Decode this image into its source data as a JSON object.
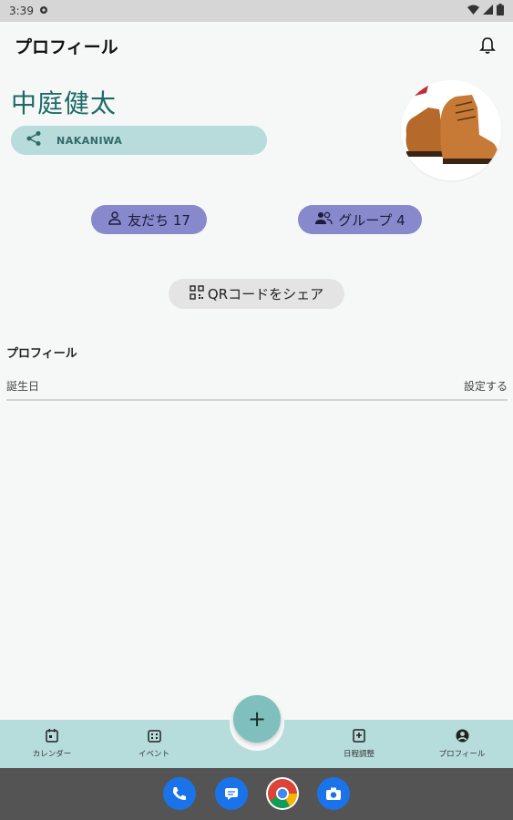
{
  "status_bar": {
    "time": "3:39"
  },
  "app_bar": {
    "title": "プロフィール"
  },
  "profile": {
    "name": "中庭健太",
    "id_text": "NAKANIWA"
  },
  "chips": {
    "friends_label": "友だち 17",
    "groups_label": "グループ 4"
  },
  "qr": {
    "label": "QRコードをシェア"
  },
  "section": {
    "title": "プロフィール",
    "birthday_label": "誕生日",
    "birthday_action": "設定する"
  },
  "bottom_nav": {
    "items": [
      {
        "label": "カレンダー",
        "icon": "calendar-icon"
      },
      {
        "label": "イベント",
        "icon": "event-icon"
      },
      {
        "label": "日程調整",
        "icon": "schedule-icon"
      },
      {
        "label": "プロフィール",
        "icon": "profile-icon"
      }
    ],
    "fab": "+"
  },
  "colors": {
    "accent_teal": "#1c6b67",
    "pill_bg": "#b7dcdb",
    "chip_purple": "#8888cc",
    "fab_bg": "#7fbfbd",
    "nav_bg": "#b6dcdb"
  }
}
